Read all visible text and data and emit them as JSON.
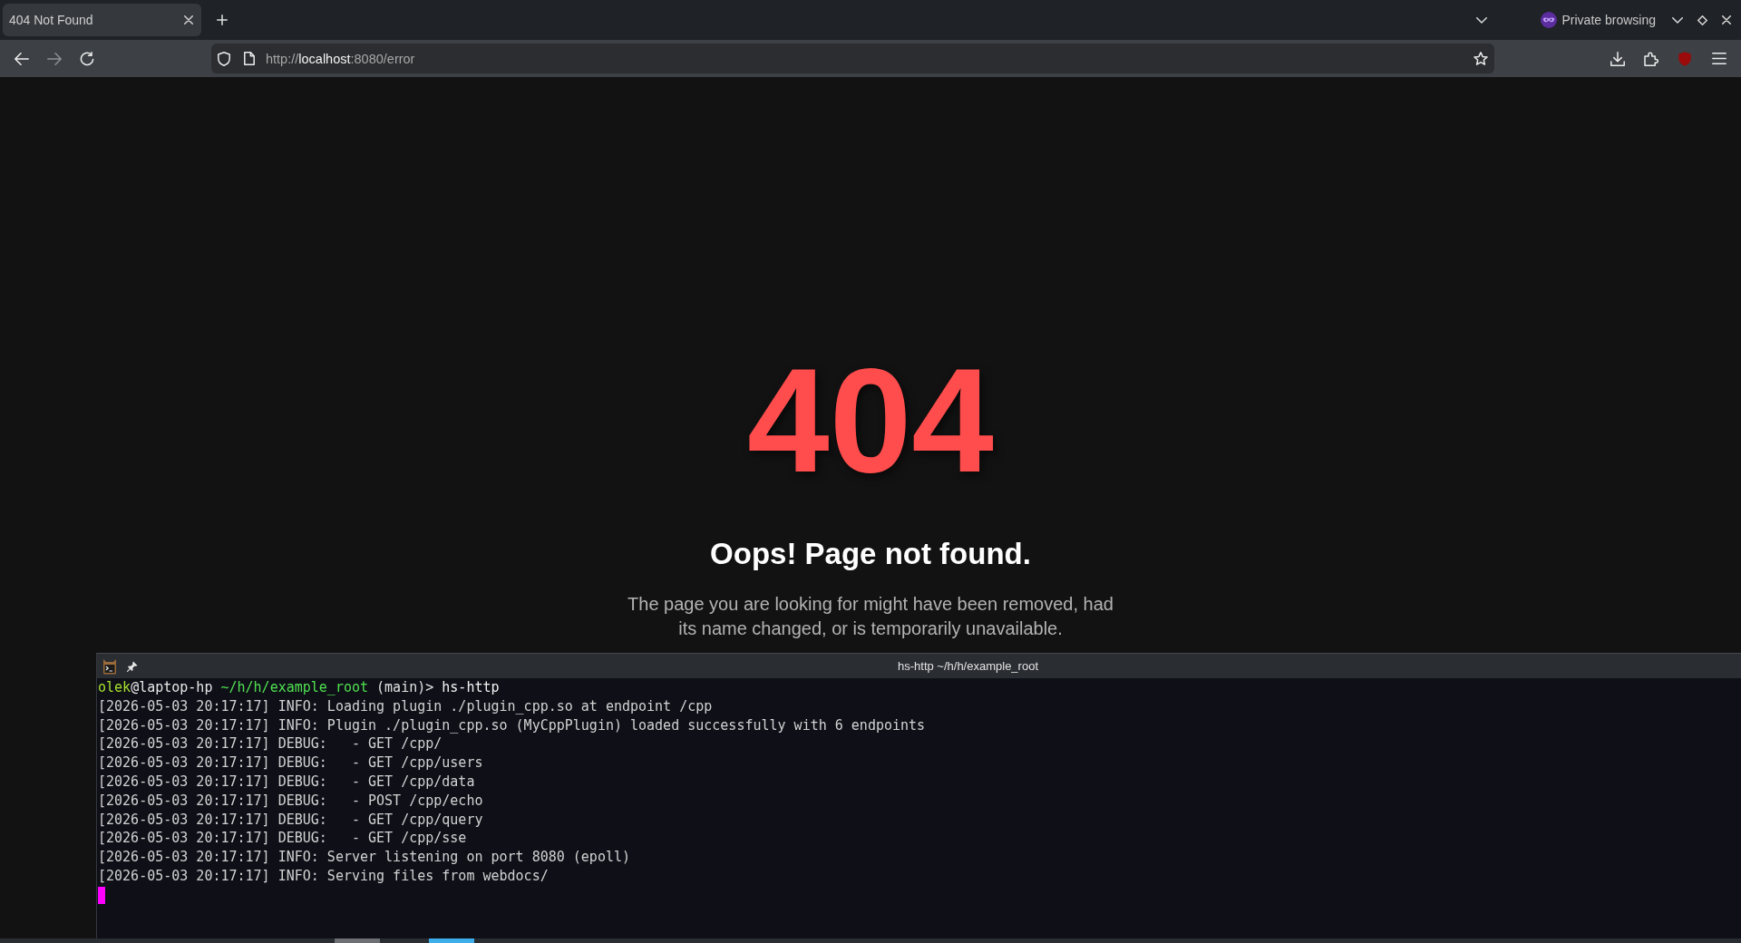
{
  "browser": {
    "tabs": [
      {
        "title": "404 Not Found",
        "selected": true
      }
    ],
    "private_mode": {
      "label": "Private browsing"
    },
    "navigation": [
      {
        "kind": "back",
        "disabled": false
      },
      {
        "kind": "forward",
        "disabled": true
      },
      {
        "kind": "reload",
        "disabled": false
      }
    ],
    "address_bar": {
      "scheme": "http://",
      "host": "localhost",
      "rest": ":8080/error"
    }
  },
  "page": {
    "code": "404",
    "heading": "Oops! Page not found.",
    "message": "The page you are looking for might have been removed, had its name changed, or is temporarily unavailable."
  },
  "terminal": {
    "title": "hs-http ~/h/h/example_root",
    "prompt": {
      "user": "olek",
      "host": "@laptop-hp",
      "path": "~/h/h/example_root",
      "branch": "(main)>",
      "command": "hs-http"
    },
    "lines": [
      "[2026-05-03 20:17:17] INFO: Loading plugin ./plugin_cpp.so at endpoint /cpp",
      "[2026-05-03 20:17:17] INFO: Plugin ./plugin_cpp.so (MyCppPlugin) loaded successfully with 6 endpoints",
      "[2026-05-03 20:17:17] DEBUG:   - GET /cpp/",
      "[2026-05-03 20:17:17] DEBUG:   - GET /cpp/users",
      "[2026-05-03 20:17:17] DEBUG:   - GET /cpp/data",
      "[2026-05-03 20:17:17] DEBUG:   - POST /cpp/echo",
      "[2026-05-03 20:17:17] DEBUG:   - GET /cpp/query",
      "[2026-05-03 20:17:17] DEBUG:   - GET /cpp/sse",
      "[2026-05-03 20:17:17] INFO: Server listening on port 8080 (epoll)",
      "[2026-05-03 20:17:17] INFO: Serving files from webdocs/"
    ]
  },
  "taskbar": {
    "items": [
      {
        "selected": false
      },
      {
        "selected": true
      }
    ]
  }
}
